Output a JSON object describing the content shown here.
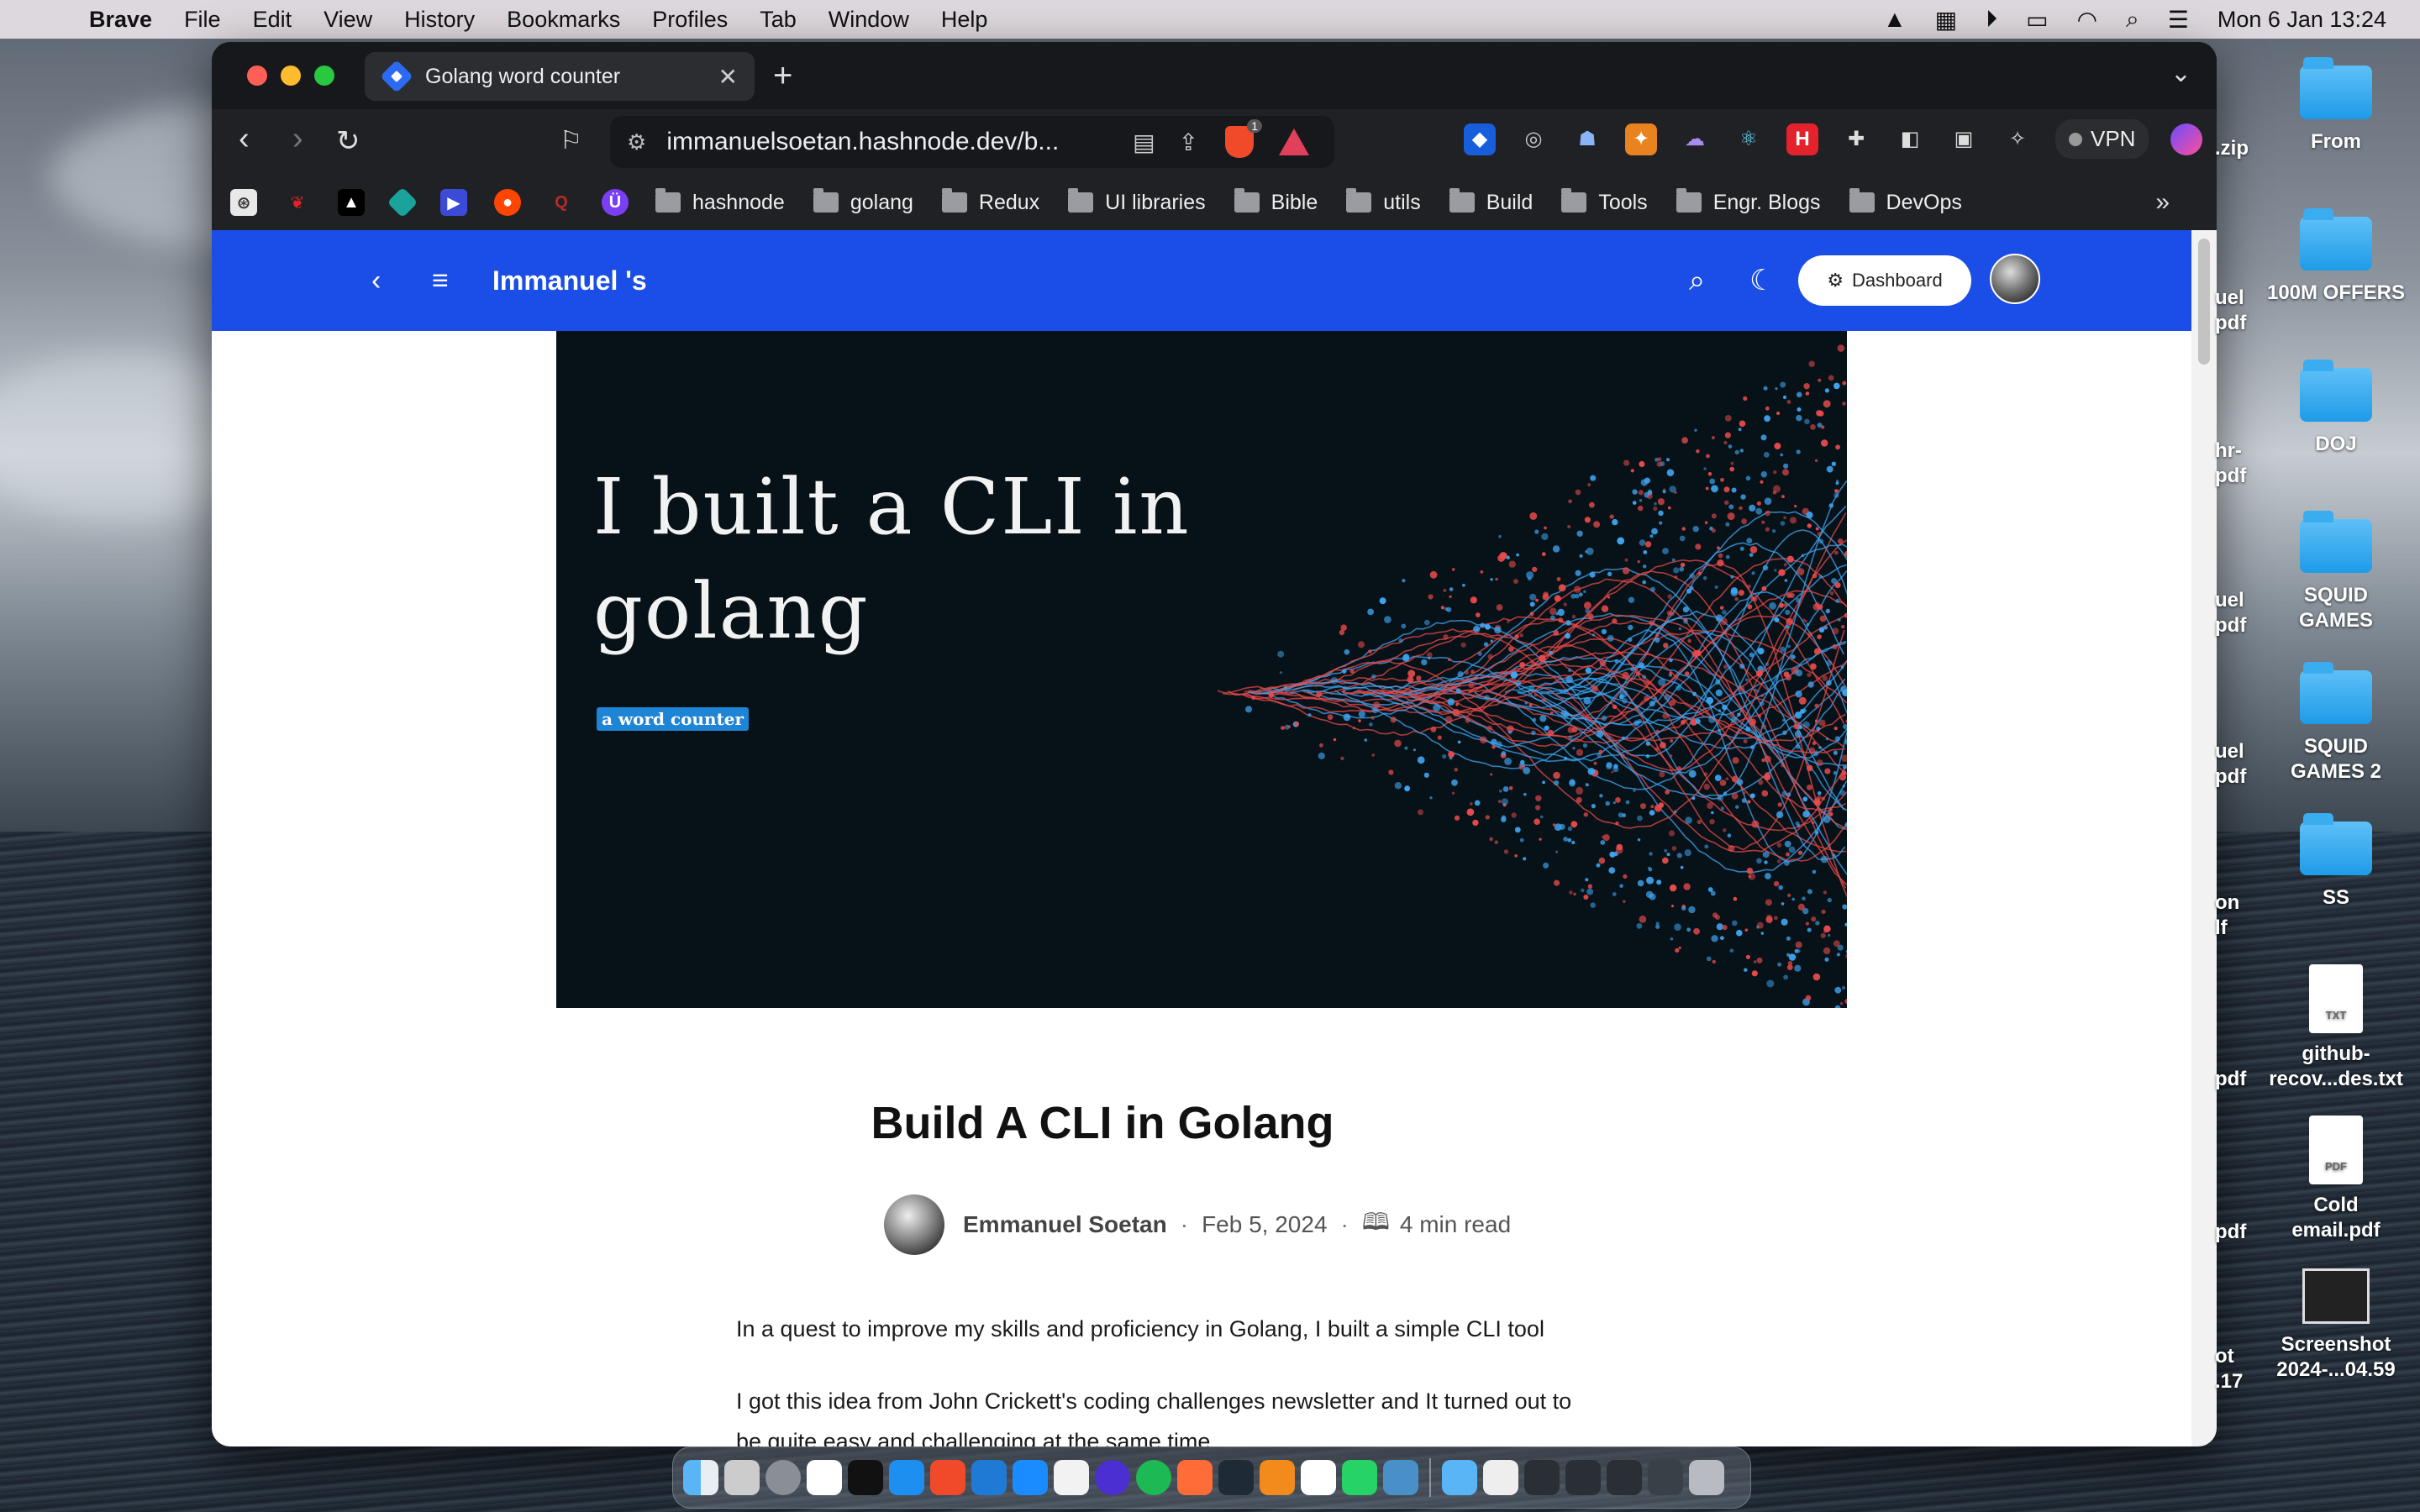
{
  "menubar": {
    "app": "Brave",
    "items": [
      "File",
      "Edit",
      "View",
      "History",
      "Bookmarks",
      "Profiles",
      "Tab",
      "Window",
      "Help"
    ],
    "clock": "Mon 6 Jan  13:24"
  },
  "browser": {
    "tab_title": "Golang word counter",
    "url": "immanuelsoetan.hashnode.dev/b...",
    "vpn_label": "VPN",
    "bookmarks": [
      "hashnode",
      "golang",
      "Redux",
      "UI libraries",
      "Bible",
      "utils",
      "Build",
      "Tools",
      "Engr. Blogs",
      "DevOps"
    ],
    "accent": "#2a6bf2"
  },
  "site": {
    "brand": "Immanuel 's",
    "dashboard_label": "Dashboard",
    "header_color": "#1b4ee6"
  },
  "hero": {
    "headline_line1": "I built a CLI  in",
    "headline_line2": "golang",
    "tag": "a word counter"
  },
  "article": {
    "title": "Build A CLI in Golang",
    "author": "Emmanuel Soetan",
    "date": "Feb 5, 2024",
    "read_time": "4 min read",
    "paragraphs": [
      "In a quest to improve my skills and proficiency in Golang, I built a simple CLI tool",
      "I got this idea from John Crickett's coding challenges newsletter and It turned out to",
      "be quite easy and challenging at the same time."
    ]
  },
  "desktop": {
    "icons": [
      {
        "label": "From",
        "kind": "folder"
      },
      {
        "label": "100M OFFERS",
        "kind": "folder"
      },
      {
        "label": "DOJ",
        "kind": "folder"
      },
      {
        "label": "SQUID\nGAMES",
        "kind": "folder"
      },
      {
        "label": "SQUID\nGAMES 2",
        "kind": "folder"
      },
      {
        "label": "SS",
        "kind": "folder"
      },
      {
        "label": "github-\nrecov...des.txt",
        "kind": "txt"
      },
      {
        "label": "Cold\nemail.pdf",
        "kind": "pdf"
      },
      {
        "label": "Screenshot\n2024-...04.59",
        "kind": "image"
      }
    ],
    "edge_labels": [
      ".zip",
      "uel\npdf",
      "hr-\npdf",
      "uel\npdf",
      "uel\npdf",
      "on\nlf",
      "pdf",
      "pdf",
      "ot\n.17"
    ]
  }
}
